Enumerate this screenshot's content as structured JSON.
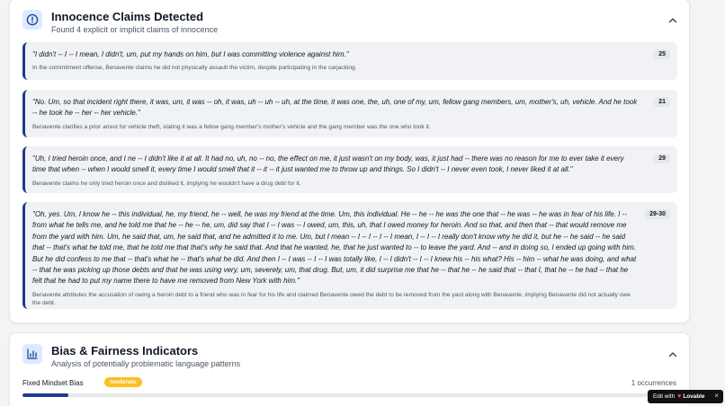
{
  "claims_section": {
    "title": "Innocence Claims Detected",
    "subtitle": "Found 4 explicit or implicit claims of innocence",
    "icon": "alert-circle-icon",
    "claims": [
      {
        "quote": "\"I didn't -- I -- I mean, I didn't, um, put my hands on him, but I was committing violence against him.\"",
        "explanation": "In the commitment offense, Benavente claims he did not physically assault the victim, despite participating in the carjacking.",
        "page": "25"
      },
      {
        "quote": "\"No. Um, so that incident right there, it was, um, it was -- oh, it was, uh -- uh -- uh, at the time, it was one, the, uh, one of my, um, fellow gang members, um, mother's, uh, vehicle. And he took -- he took he -- her -- her vehicle.\"",
        "explanation": "Benavente clarifies a prior arrest for vehicle theft, stating it was a fellow gang member's mother's vehicle and the gang member was the one who took it.",
        "page": "21"
      },
      {
        "quote": "\"Uh, I tried heroin once, and I ne -- I didn't like it at all. It had no, uh, no -- no, the effect on me, it just wasn't on my body, was, it just had -- there was no reason for me to ever take it every time that when -- when I would smell it, every time I would smell that it -- it -- it just wanted me to throw up and things. So I didn't -- I never even took, I never liked it at all.\"",
        "explanation": "Benavente claims he only tried heroin once and disliked it, implying he wouldn't have a drug debt for it.",
        "page": "29"
      },
      {
        "quote": "\"Oh, yes. Um, I know he -- this individual, he, my friend, he -- well, he was my friend at the time. Um, this individual. He -- he -- he was the one that -- he was -- he was in fear of his life. I -- from what he tells me, and he told me that he -- he -- he, um, did say that I -- I was -- I owed, um, this, uh, that I owed money for heroin. And so that, and then that -- that would remove me from the yard with him. Um, he said that, um, he said that, and he admitted it to me. Um, but I mean -- I -- I -- I -- I mean, I -- I -- I really don't know why he did it, but he -- he said -- he said that -- that's what he told me, that he told me that that's why he said that. And that he wanted, he, that he just wanted to -- to leave the yard. And -- and in doing so, I ended up going with him. But he did confess to me that -- that's what he -- that's what he did. And then I -- I was -- I -- I was totally like, I -- I didn't -- I -- I knew his -- his what? His -- him -- what he was doing, and what -- that he was picking up those debts and that he was using very, um, severely, um, that drug. But, um, it did surprise me that he -- that he -- he said that -- that I, that he -- he had -- that he felt that he had to put my name there to have me removed from New York with him.\"",
        "explanation": "Benavente attributes the accusation of owing a heroin debt to a friend who was in fear for his life and claimed Benavente owed the debt to be removed from the yard along with Benavente, implying Benavente did not actually owe the debt.",
        "page": "29-30"
      }
    ]
  },
  "bias_section": {
    "title": "Bias & Fairness Indicators",
    "subtitle": "Analysis of potentially problematic language patterns",
    "icon": "bar-chart-icon",
    "indicators": [
      {
        "label": "Fixed Mindset Bias",
        "severity": "moderate",
        "count": "1 occurrences",
        "level_percent": 7
      }
    ]
  },
  "lovable_badge": {
    "prefix": "Edit with",
    "brand": "Lovable",
    "close": "×"
  },
  "colors": {
    "accent": "#1e3a8a",
    "claim_bg": "#f1f2f5",
    "moderate_chip": "#fbbf24"
  }
}
